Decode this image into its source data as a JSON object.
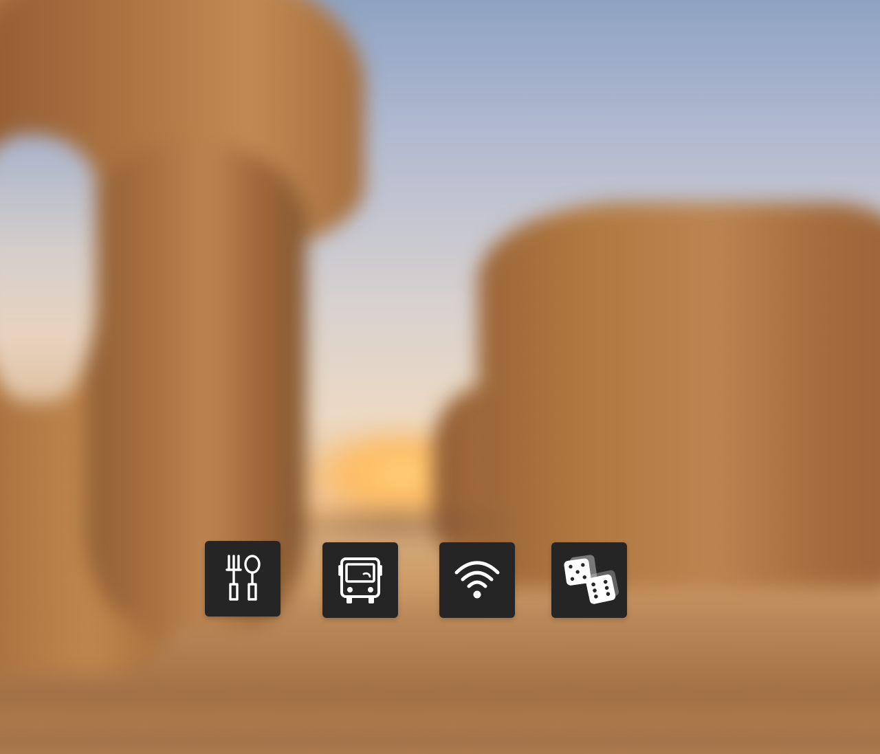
{
  "scene": {
    "type": "blurred-desert-background"
  },
  "feature_tiles": [
    {
      "icon": "fork-spoon-icon"
    },
    {
      "icon": "bus-icon"
    },
    {
      "icon": "wifi-icon"
    },
    {
      "icon": "dice-icon"
    }
  ],
  "colors": {
    "tile_background": "#252525",
    "icon_foreground": "#ffffff"
  }
}
